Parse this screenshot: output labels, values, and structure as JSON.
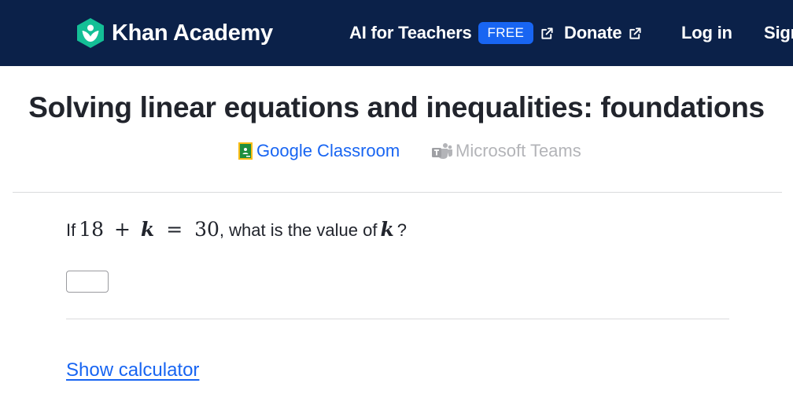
{
  "header": {
    "logo_text": "Khan Academy",
    "nav": {
      "ai_for_teachers": "AI for Teachers",
      "free_badge": "FREE",
      "donate": "Donate",
      "login": "Log in",
      "signup": "Sign up"
    }
  },
  "page": {
    "title": "Solving linear equations and inequalities: foundations",
    "share": {
      "google_classroom": "Google Classroom",
      "microsoft_teams": "Microsoft Teams"
    }
  },
  "question": {
    "prefix": "If",
    "equation": {
      "n1": "18",
      "op1": "+",
      "var": "k",
      "op2": "=",
      "n2": "30"
    },
    "middle": ", what is the value of",
    "var": "k",
    "suffix": "?",
    "answer_value": ""
  },
  "tools": {
    "show_calculator": "Show calculator"
  },
  "colors": {
    "header_bg": "#0b2149",
    "accent_blue": "#1865f2",
    "logo_green": "#14bf96",
    "text": "#21242c",
    "muted": "#b3b4b8"
  },
  "icons": {
    "logo": "khan-academy-logo-icon",
    "external": "external-link-icon",
    "google_classroom": "google-classroom-icon",
    "microsoft_teams": "microsoft-teams-icon"
  }
}
